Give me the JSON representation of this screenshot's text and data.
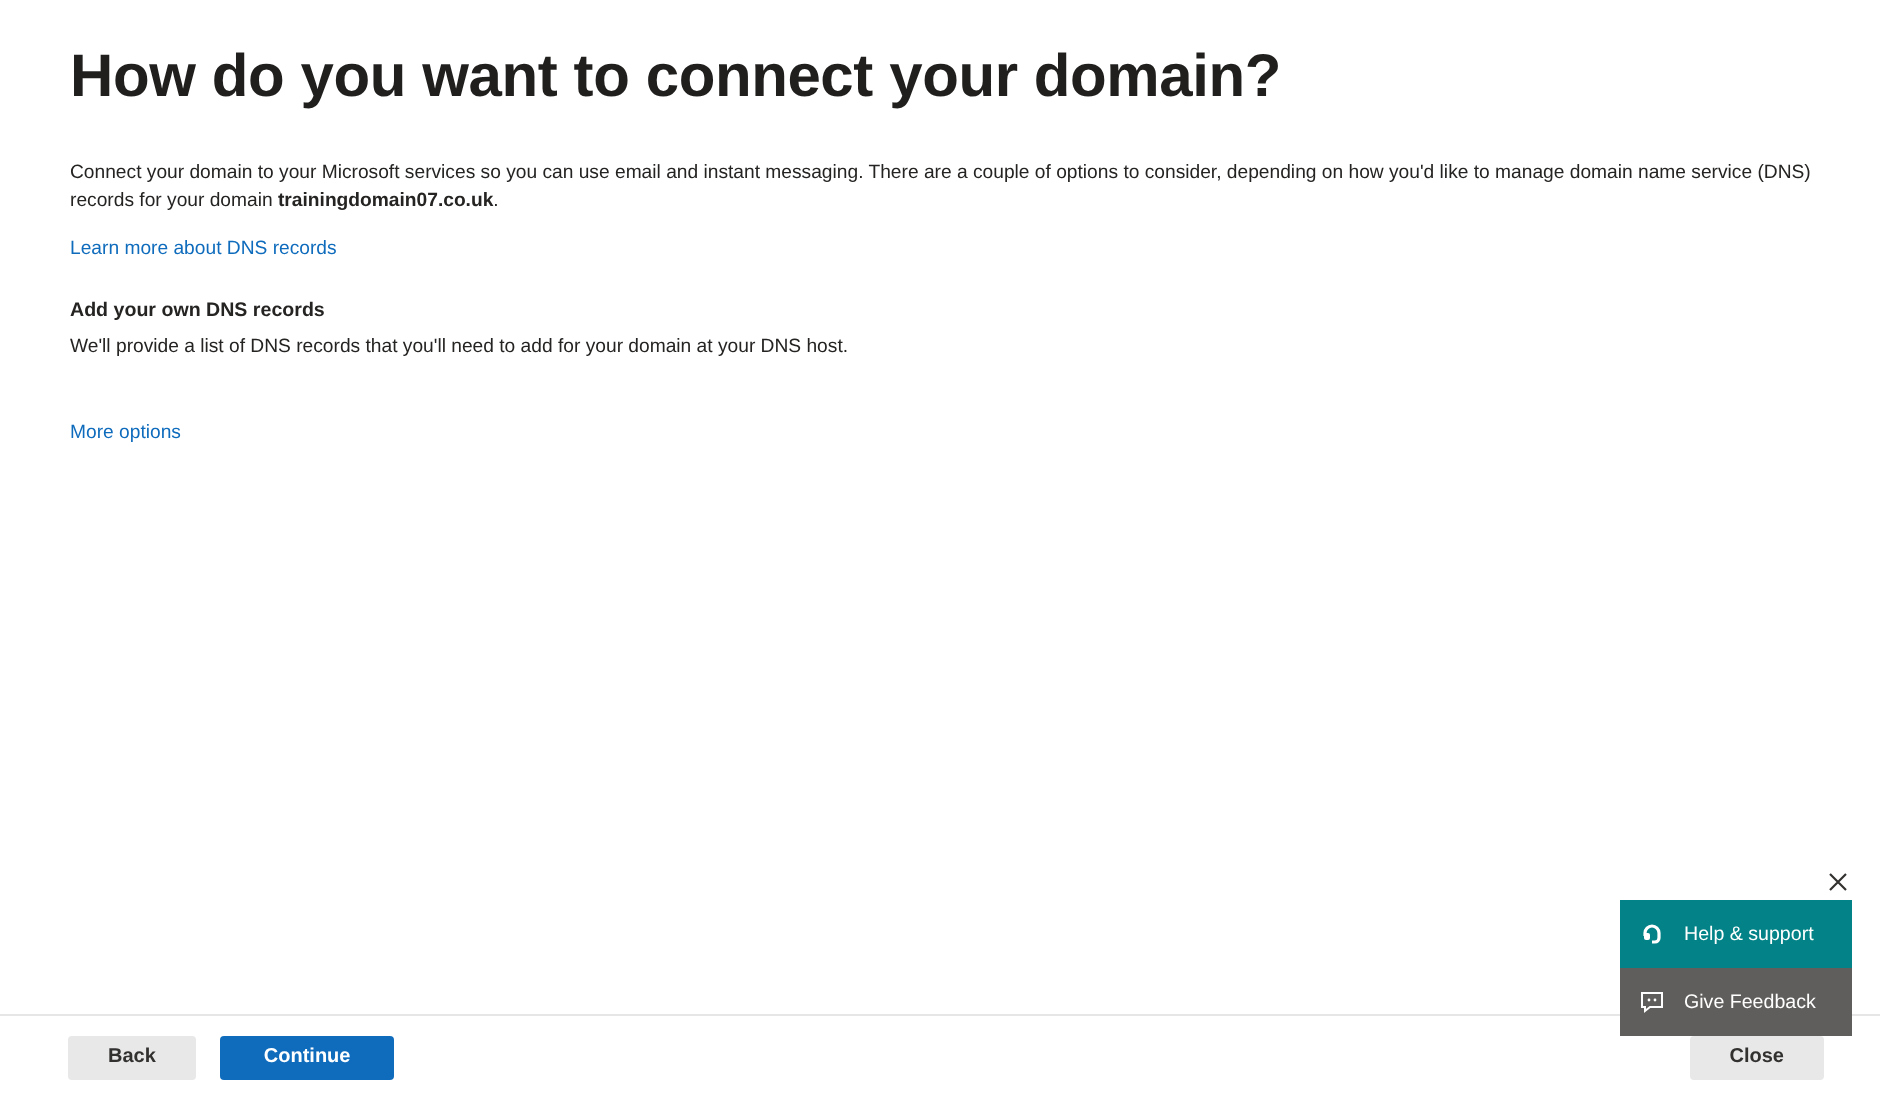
{
  "title": "How do you want to connect your domain?",
  "intro": "Connect your domain to your Microsoft services so you can use email and instant messaging. There are a couple of options to consider, depending on how you'd like to manage domain name service (DNS) records for your domain **trainingdomain07.co.uk**.",
  "learn_more_link": "Learn more about DNS records",
  "option": {
    "heading": "Add your own DNS records",
    "description": "We'll provide a list of DNS records that you'll need to add for your domain at your DNS host."
  },
  "more_options_link": "More options",
  "help_panel": {
    "items": [
      {
        "kind": "help",
        "label": "Help & support"
      },
      {
        "kind": "feedback",
        "label": "Give Feedback"
      }
    ]
  },
  "footer": {
    "buttons": [
      {
        "label": "Back",
        "primary": false
      },
      {
        "label": "Continue",
        "primary": true
      }
    ],
    "close_button": "Close"
  }
}
